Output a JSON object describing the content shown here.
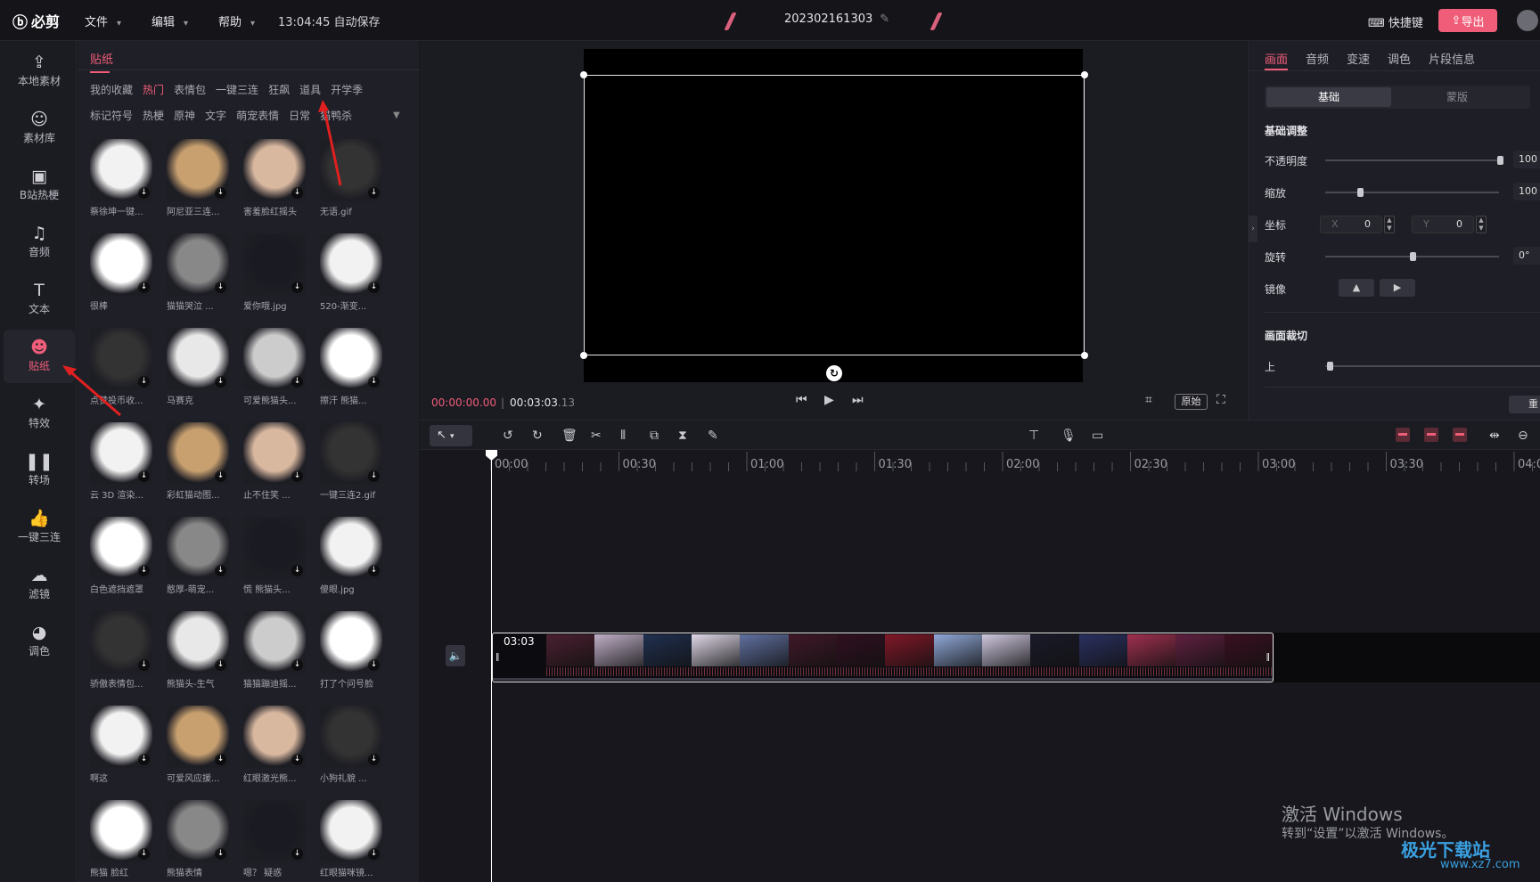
{
  "topbar": {
    "logo": "必剪",
    "menus": [
      "文件",
      "编辑",
      "帮助"
    ],
    "autosave": "13:04:45 自动保存",
    "project_name": "202302161303",
    "shortcut": "快捷键",
    "export": "导出"
  },
  "sidenav": [
    {
      "label": "本地素材",
      "icon": "upload-icon"
    },
    {
      "label": "素材库",
      "icon": "library-icon"
    },
    {
      "label": "B站热梗",
      "icon": "bilibili-icon"
    },
    {
      "label": "音频",
      "icon": "music-icon"
    },
    {
      "label": "文本",
      "icon": "text-icon"
    },
    {
      "label": "贴纸",
      "icon": "sticker-icon",
      "active": true
    },
    {
      "label": "特效",
      "icon": "effect-icon"
    },
    {
      "label": "转场",
      "icon": "transition-icon"
    },
    {
      "label": "一键三连",
      "icon": "thumbs-up-icon"
    },
    {
      "label": "滤镜",
      "icon": "filter-icon"
    },
    {
      "label": "调色",
      "icon": "palette-icon"
    }
  ],
  "stickers": {
    "title": "贴纸",
    "cat_row1": [
      "我的收藏",
      "热门",
      "表情包",
      "一键三连",
      "狂飙",
      "道具",
      "开学季"
    ],
    "cat_row2": [
      "标记符号",
      "热梗",
      "原神",
      "文字",
      "萌宠表情",
      "日常",
      "猫鸭杀"
    ],
    "active_cat": "热门",
    "items": [
      "蔡徐坤一键...",
      "阿尼亚三连...",
      "害羞脸红摇头",
      "无语.gif",
      "很棒",
      "猫猫哭泣 ...",
      "爱你哦.jpg",
      "520-渐变...",
      "点赞投币收...",
      "马赛克",
      "可爱熊猫头...",
      "擦汗 熊猫...",
      "云 3D 渲染...",
      "彩虹猫动图...",
      "止不住笑 ...",
      "一键三连2.gif",
      "白色遮挡遮罩",
      "憨厚-萌宠...",
      "慌 熊猫头...",
      "傻眼.jpg",
      "骄傲表情包...",
      "熊猫头-生气",
      "猫猫蹦迪摇...",
      "打了个问号脸",
      "啊这",
      "可爱风应援...",
      "红眼激光熊...",
      "小狗礼貌 ...",
      "熊猫 脸红",
      "熊猫表情",
      "嗯？ 疑惑",
      "红眼猫咪镜..."
    ]
  },
  "preview": {
    "current_time": "00:00:00.00",
    "separator": "|",
    "total_time": "00:03:03",
    "total_frames": ".13",
    "original_label": "原始"
  },
  "right_panel": {
    "tabs": [
      "画面",
      "音频",
      "变速",
      "调色",
      "片段信息"
    ],
    "active_tab": "画面",
    "seg_basic": "基础",
    "seg_mask": "蒙版",
    "section_basic": "基础调整",
    "opacity_label": "不透明度",
    "opacity_value": "100",
    "opacity": 1.0,
    "scale_label": "缩放",
    "scale_value": "100",
    "position_label": "坐标",
    "x_key": "X",
    "x_value": "0",
    "y_key": "Y",
    "y_value": "0",
    "rotate_label": "旋转",
    "rotate_value": "0°",
    "mirror_label": "镜像",
    "crop_title": "画面裁切",
    "crop_top_label": "上",
    "reset": "重"
  },
  "timeline": {
    "ruler_labels": [
      "00:00",
      "00:30",
      "01:00",
      "01:30",
      "02:00",
      "02:30",
      "03:00",
      "03:30",
      "04:0"
    ],
    "clip_duration": "03:03"
  },
  "watermark": {
    "line1": "激活 Windows",
    "line2": "转到“设置”以激活 Windows。",
    "site_logo": "极光下载站",
    "site_url": "www.xz7.com"
  },
  "colors": {
    "accent": "#f05d79",
    "bg": "#17171d",
    "panel": "#1f1f27"
  }
}
